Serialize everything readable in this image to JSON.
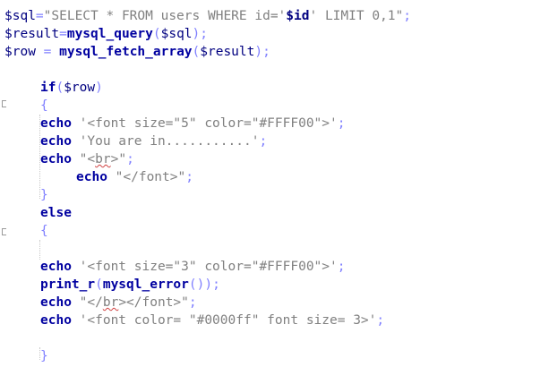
{
  "code": {
    "l1": {
      "var": "$sql",
      "eq": "=",
      "str1": "\"SELECT * FROM users WHERE id='",
      "strvar": "$id",
      "str2": "' LIMIT 0,1\"",
      "semi": ";"
    },
    "l2": {
      "var": "$result",
      "eq": "=",
      "fn": "mysql_query",
      "open": "(",
      "arg": "$sql",
      "close": ")",
      "semi": ";"
    },
    "l3": {
      "var": "$row",
      "eq": " = ",
      "fn": "mysql_fetch_array",
      "open": "(",
      "arg": "$result",
      "close": ")",
      "semi": ";"
    },
    "l4": {
      "kw": "if",
      "open": "(",
      "arg": "$row",
      "close": ")"
    },
    "l5": {
      "brace": "{"
    },
    "l6": {
      "kw": "echo",
      "str": " '<font size=\"5\" color=\"#FFFF00\">'",
      "semi": ";"
    },
    "l7": {
      "kw": "echo",
      "str": " 'You are in...........'",
      "semi": ";"
    },
    "l8": {
      "kw": "echo",
      "str_a": " \"<",
      "squiggle": "br",
      "str_b": ">\"",
      "semi": ";"
    },
    "l9": {
      "kw": "echo",
      "str": " \"</font>\"",
      "semi": ";"
    },
    "l10": {
      "brace": "}"
    },
    "l11": {
      "kw": "else"
    },
    "l12": {
      "brace": "{"
    },
    "l13": {
      "kw": "echo",
      "str": " '<font size=\"3\" color=\"#FFFF00\">'",
      "semi": ";"
    },
    "l14": {
      "fn1": "print_r",
      "open1": "(",
      "fn2": "mysql_error",
      "open2": "(",
      "close2": ")",
      "close1": ")",
      "semi": ";"
    },
    "l15": {
      "kw": "echo",
      "str_a": " \"</",
      "squiggle": "br",
      "str_b": "></font>\"",
      "semi": ";"
    },
    "l16": {
      "kw": "echo",
      "str": " '<font color= \"#0000ff\" font size= 3>'",
      "semi": ";"
    },
    "l17": {
      "brace": "}"
    }
  },
  "colors": {
    "background": "#ffffff",
    "variable": "#000080",
    "keyword": "#0000a0",
    "string": "#808080",
    "operator": "#8080ff"
  }
}
